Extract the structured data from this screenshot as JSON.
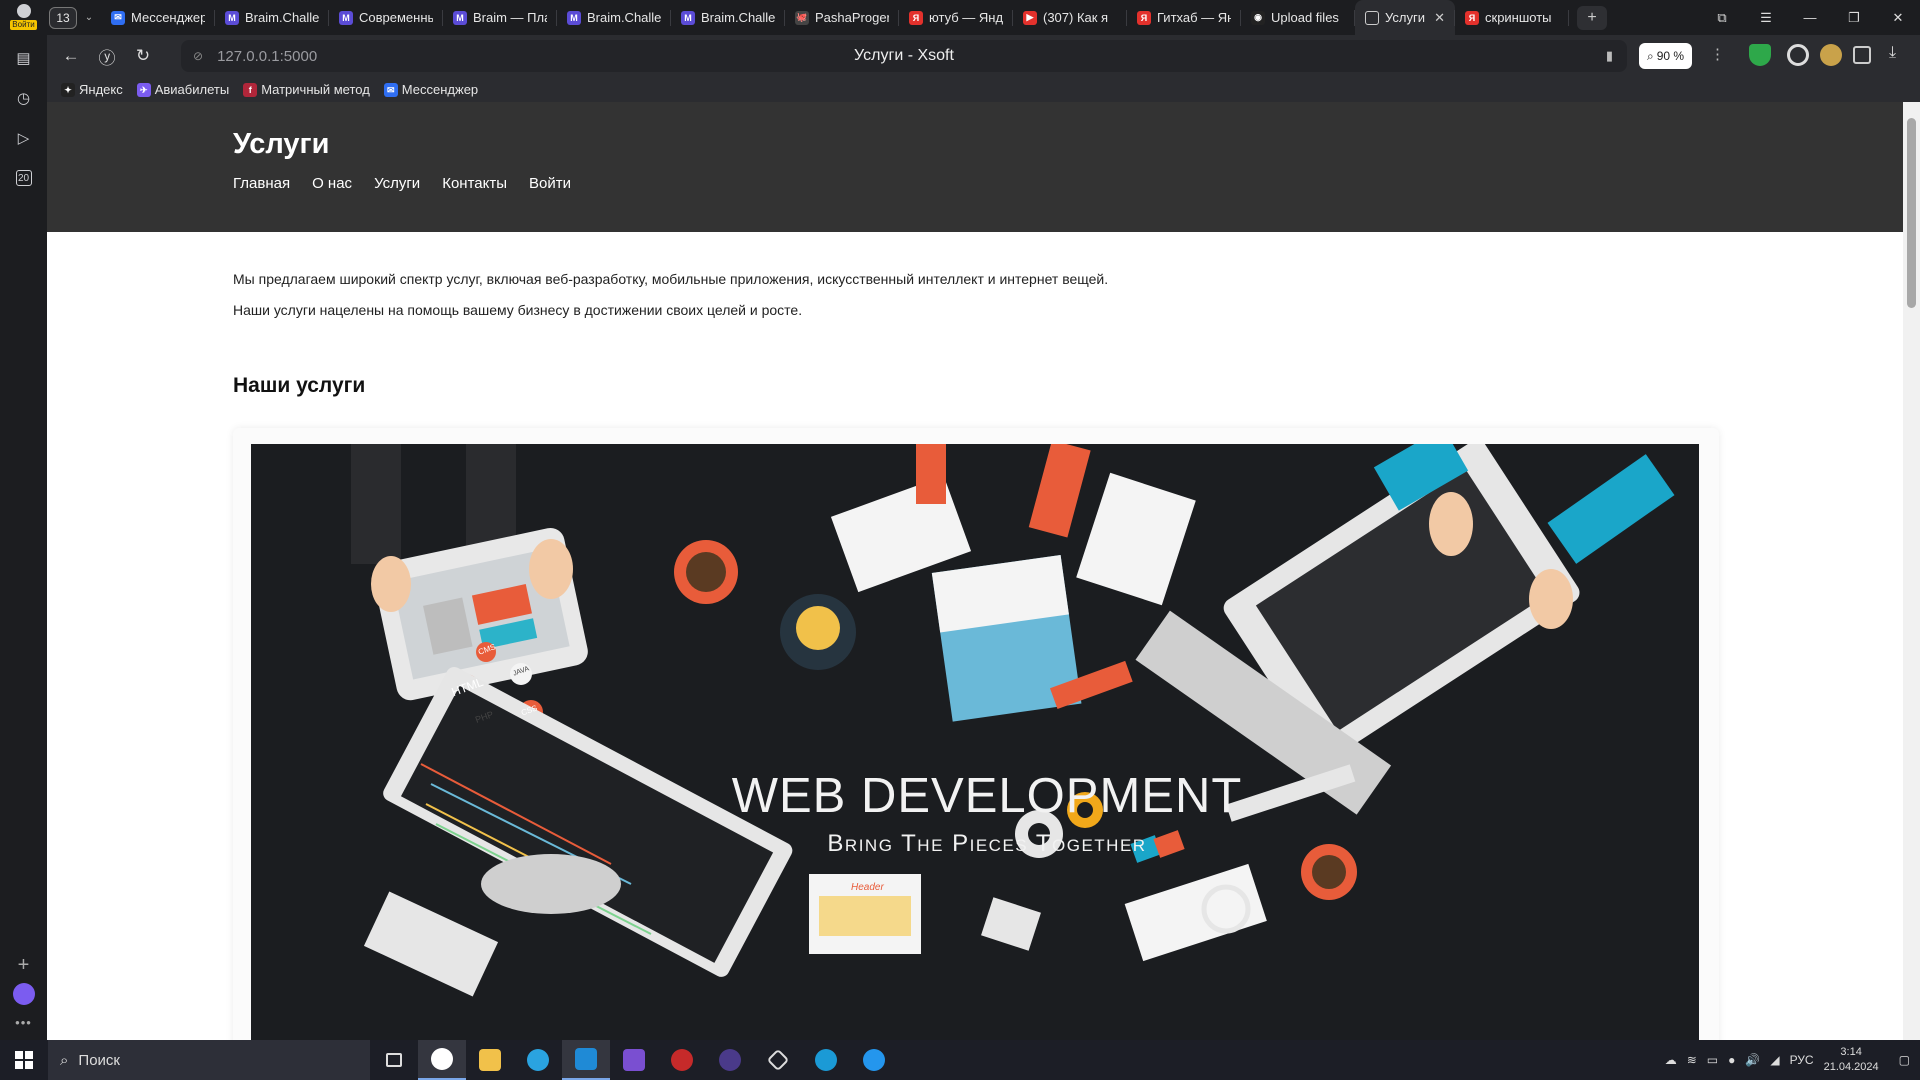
{
  "sidebar": {
    "login_label": "Войти",
    "tab_counter_badge": "20"
  },
  "tabstrip": {
    "tab_count": "13",
    "tabs": [
      {
        "label": "Мессенджер",
        "fav_color": "#2f6ef2",
        "fav_text": "✉"
      },
      {
        "label": "Braim.Challenge",
        "fav_color": "#5b4cd6",
        "fav_text": "M"
      },
      {
        "label": "Современные",
        "fav_color": "#5b4cd6",
        "fav_text": "M"
      },
      {
        "label": "Braim — Платформа",
        "fav_color": "#5b4cd6",
        "fav_text": "M"
      },
      {
        "label": "Braim.Challenge",
        "fav_color": "#5b4cd6",
        "fav_text": "M"
      },
      {
        "label": "Braim.Challenge",
        "fav_color": "#5b4cd6",
        "fav_text": "M"
      },
      {
        "label": "PashaProger",
        "fav_color": "#444",
        "fav_text": "🐙"
      },
      {
        "label": "ютуб — Яндекс",
        "fav_color": "#e3312c",
        "fav_text": "Я"
      },
      {
        "label": "(307) Как я",
        "fav_color": "#e3312c",
        "fav_text": "▶"
      },
      {
        "label": "Гитхаб — Яндекс",
        "fav_color": "#e3312c",
        "fav_text": "Я"
      },
      {
        "label": "Upload files",
        "fav_color": "#222",
        "fav_text": "◉"
      }
    ],
    "active_tab": {
      "label": "Услуги - Xsoft"
    },
    "last_tab": {
      "label": "скриншоты",
      "fav_color": "#e3312c",
      "fav_text": "Я"
    }
  },
  "toolbar": {
    "url": "127.0.0.1:5000",
    "page_title": "Услуги - Xsoft",
    "zoom": "90 %"
  },
  "bookmarks": [
    {
      "label": "Яндекс",
      "color": "#222",
      "glyph": "✦"
    },
    {
      "label": "Авиабилеты",
      "color": "#7b5cf0",
      "glyph": "✈"
    },
    {
      "label": "Матричный метод",
      "color": "#b0263a",
      "glyph": "f"
    },
    {
      "label": "Мессенджер",
      "color": "#2f6ef2",
      "glyph": "✉"
    }
  ],
  "page": {
    "heading": "Услуги",
    "nav": [
      "Главная",
      "О нас",
      "Услуги",
      "Контакты",
      "Войти"
    ],
    "intro_1": "Мы предлагаем широкий спектр услуг, включая веб-разработку, мобильные приложения, искусственный интеллект и интернет вещей.",
    "intro_2": "Наши услуги нацелены на помощь вашему бизнесу в достижении своих целей и росте.",
    "services_heading": "Наши услуги",
    "banner_title": "WEB DEVELOPMENT",
    "banner_subtitle": "Bring The Pieces Together",
    "banner_chips": [
      "HTML",
      "PHP",
      "CSS",
      "CMS",
      "JAVA"
    ],
    "banner_header_label": "Header"
  },
  "taskbar": {
    "search_placeholder": "Поиск",
    "lang": "РУС",
    "time": "3:14",
    "date": "21.04.2024"
  },
  "colors": {
    "page_header_bg": "#333333",
    "browser_chrome": "#2b2c30",
    "banner_bg": "#1b1d20"
  }
}
